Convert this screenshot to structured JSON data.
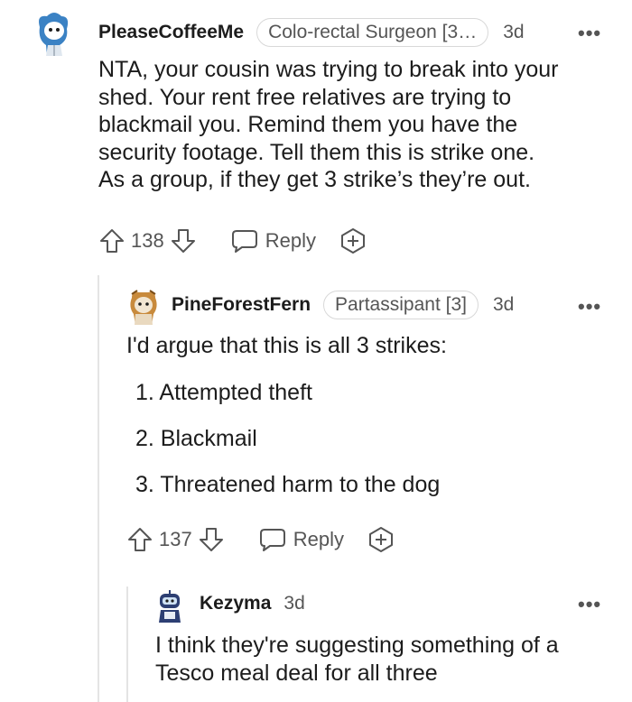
{
  "comments": [
    {
      "username": "PleaseCoffeeMe",
      "flair": "Colo-rectal Surgeon [3…",
      "age": "3d",
      "more": "•••",
      "body": [
        "NTA, your cousin was trying to break into your",
        "shed. Your rent free relatives are trying to",
        "blackmail you. Remind them you have the",
        "security footage. Tell them this is strike one.",
        "As a group, if they get 3 strike’s they’re out."
      ],
      "votes": "138",
      "reply": "Reply"
    },
    {
      "username": "PineForestFern",
      "flair": "Partassipant [3]",
      "age": "3d",
      "more": "•••",
      "intro": "I'd argue that this is all 3 strikes:",
      "list": [
        "1. Attempted theft",
        "2. Blackmail",
        "3. Threatened harm to the dog"
      ],
      "votes": "137",
      "reply": "Reply"
    },
    {
      "username": "Kezyma",
      "age": "3d",
      "more": "•••",
      "body": [
        "I think they're suggesting something of a",
        "Tesco meal deal for all three"
      ]
    }
  ],
  "icons": {
    "upvote": "upvote-icon",
    "downvote": "downvote-icon",
    "reply": "reply-bubble-icon",
    "award": "award-plus-icon",
    "more": "more-options-icon"
  }
}
